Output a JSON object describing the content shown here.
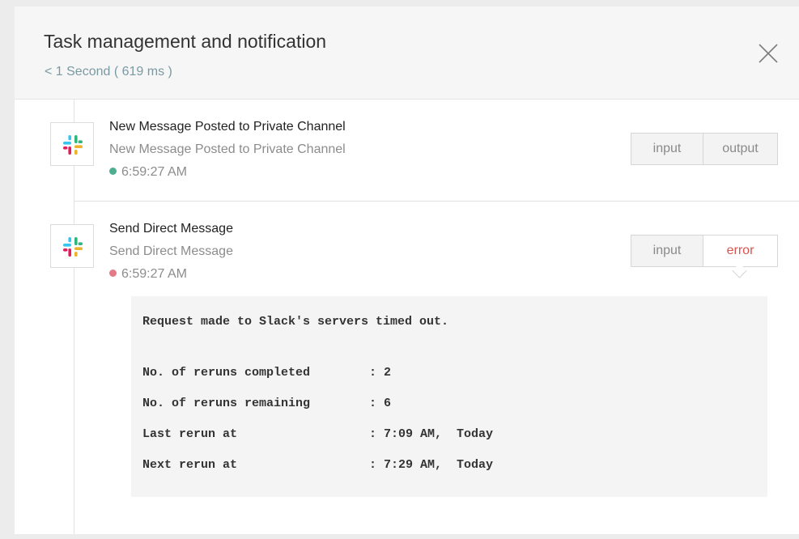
{
  "header": {
    "title": "Task management and notification",
    "subtitle": "< 1 Second ( 619 ms )",
    "close_icon": "close-icon"
  },
  "colors": {
    "success_dot": "#4caf8f",
    "error_dot": "#e57a86",
    "error_tab_text": "#d9534f"
  },
  "tasks": [
    {
      "icon": "slack-icon",
      "title": "New Message Posted to Private Channel",
      "subtitle": "New Message Posted to Private Channel",
      "time": "6:59:27 AM",
      "status": "success",
      "tabs": [
        "input",
        "output"
      ]
    },
    {
      "icon": "slack-icon",
      "title": "Send Direct Message",
      "subtitle": "Send Direct Message",
      "time": "6:59:27 AM",
      "status": "error",
      "tabs": [
        "input",
        "error"
      ],
      "active_tab": "error"
    }
  ],
  "error_details": {
    "message": "Request made to Slack's servers timed out.",
    "rows": [
      {
        "key": "No. of reruns completed",
        "value": ": 2"
      },
      {
        "key": "No. of reruns remaining",
        "value": ": 6"
      },
      {
        "key": "Last rerun at",
        "value": ": 7:09 AM,  Today"
      },
      {
        "key": "Next rerun at",
        "value": ": 7:29 AM,  Today"
      }
    ]
  }
}
